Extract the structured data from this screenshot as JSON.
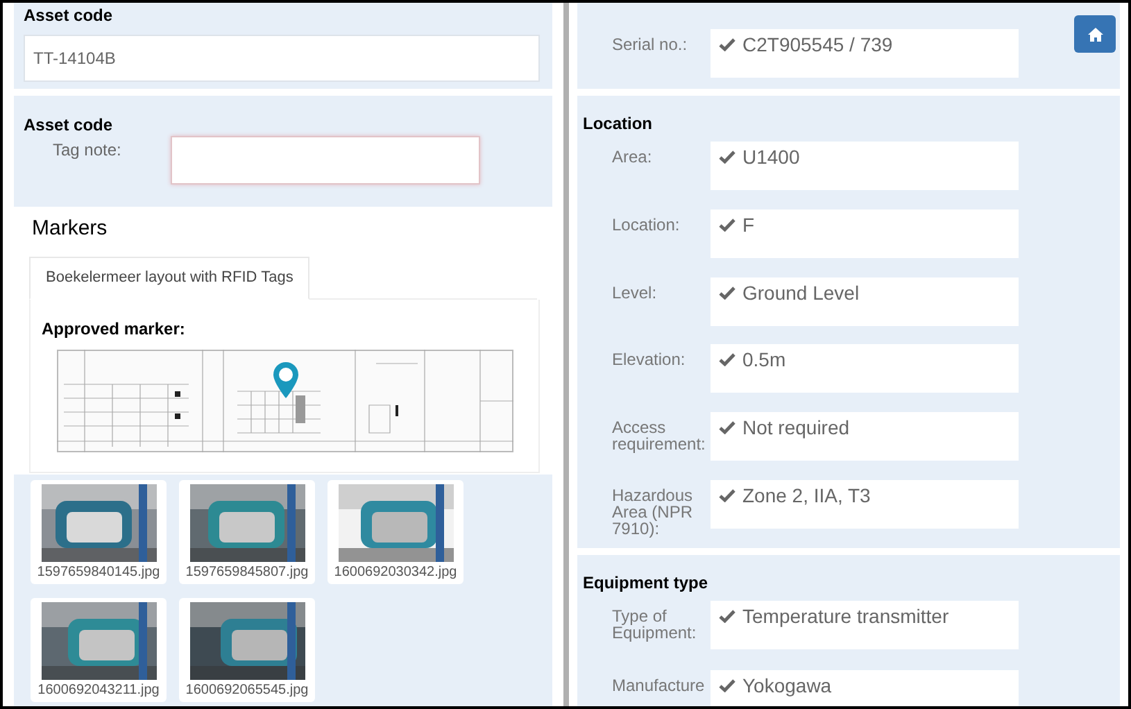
{
  "asset_code": {
    "title": "Asset code",
    "value": "TT-14104B"
  },
  "tag_section": {
    "title": "Asset code",
    "label": "Tag note:"
  },
  "markers": {
    "title": "Markers",
    "tabs": [
      {
        "label": "Boekelermeer layout with RFID Tags",
        "selected": true
      }
    ],
    "approved_label": "Approved marker:"
  },
  "photos": [
    {
      "filename": "1597659840145.jpg"
    },
    {
      "filename": "1597659845807.jpg"
    },
    {
      "filename": "1600692030342.jpg"
    },
    {
      "filename": "1600692043211.jpg"
    },
    {
      "filename": "1600692065545.jpg"
    }
  ],
  "serial": {
    "label": "Serial no.:",
    "value": "C2T905545 / 739",
    "verified": true
  },
  "sections": [
    {
      "title": "Location",
      "fields": [
        {
          "label": "Area:",
          "value": "U1400",
          "verified": true
        },
        {
          "label": "Location:",
          "value": "F",
          "verified": true
        },
        {
          "label": "Level:",
          "value": "Ground Level",
          "verified": true
        },
        {
          "label": "Elevation:",
          "value": "0.5m",
          "verified": true
        },
        {
          "label": "Access requirement:",
          "value": "Not required",
          "verified": true
        },
        {
          "label": "Hazardous Area (NPR 7910):",
          "value": "Zone 2, IIA, T3",
          "verified": true
        }
      ]
    },
    {
      "title": "Equipment type",
      "fields": [
        {
          "label": "Type of Equipment:",
          "value": "Temperature transmitter",
          "verified": true
        },
        {
          "label": "Manufacture",
          "value": "Yokogawa",
          "verified": true
        }
      ]
    }
  ]
}
